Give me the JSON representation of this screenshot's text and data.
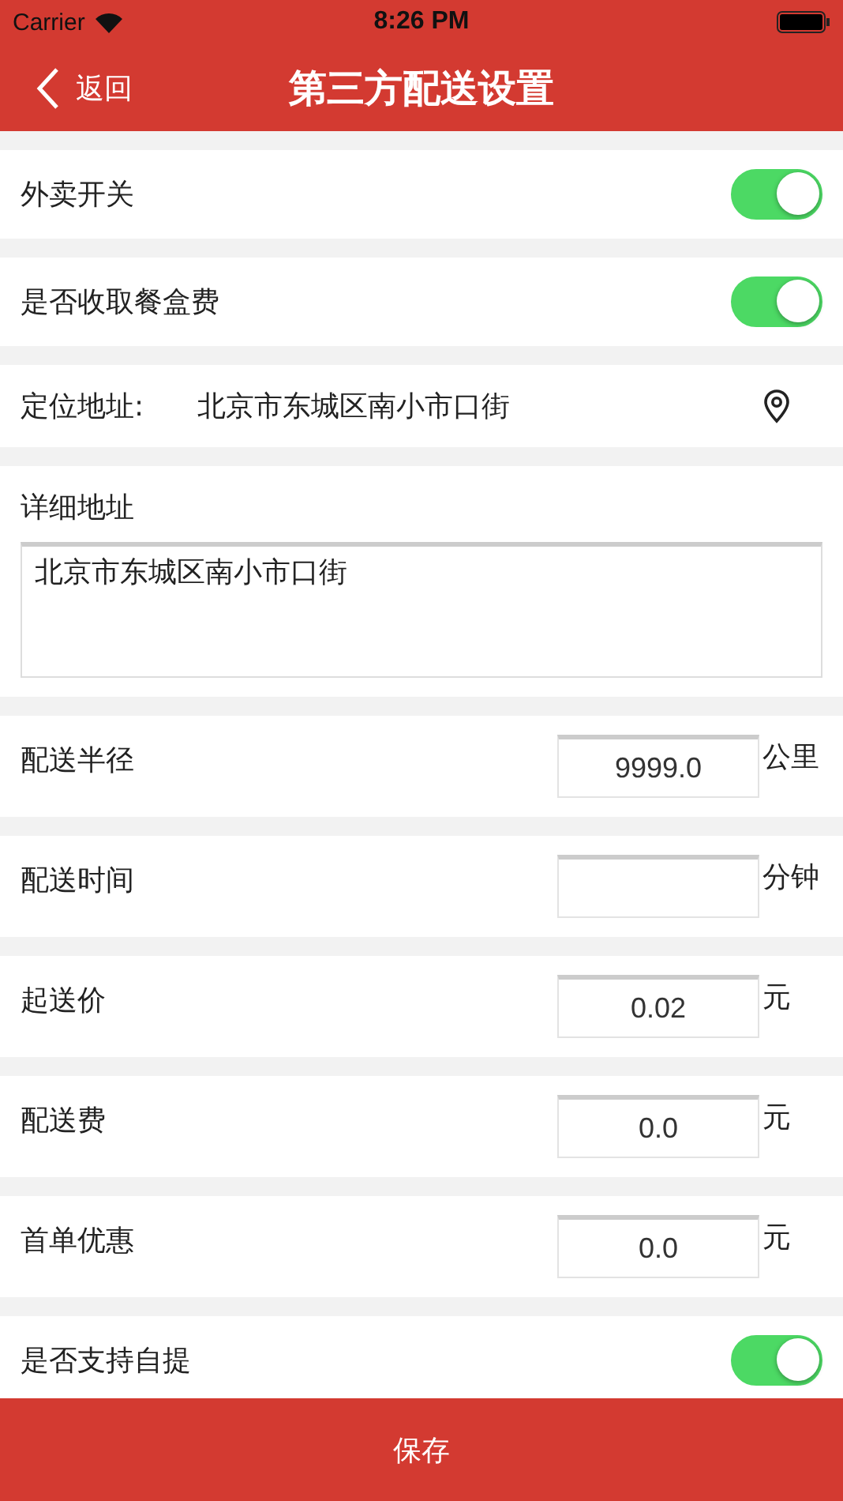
{
  "status_bar": {
    "carrier": "Carrier",
    "time": "8:26 PM"
  },
  "nav": {
    "back": "返回",
    "title": "第三方配送设置"
  },
  "toggles": [
    {
      "label": "外卖开关",
      "on": true
    },
    {
      "label": "是否收取餐盒费",
      "on": true
    }
  ],
  "location": {
    "label": "定位地址:",
    "value": "北京市东城区南小市口街"
  },
  "detail_address": {
    "label": "详细地址",
    "value": "北京市东城区南小市口街"
  },
  "inputs": [
    {
      "label": "配送半径",
      "value": "9999.0",
      "unit": "公里"
    },
    {
      "label": "配送时间",
      "unit": "分钟"
    },
    {
      "label": "起送价",
      "value": "0.02",
      "unit": "元"
    },
    {
      "label": "配送费",
      "value": "0.0",
      "unit": "元"
    },
    {
      "label": "首单优惠",
      "value": "0.0",
      "unit": "元"
    }
  ],
  "self_pickup": {
    "label": "是否支持自提",
    "on": true
  },
  "save_button": "保存"
}
